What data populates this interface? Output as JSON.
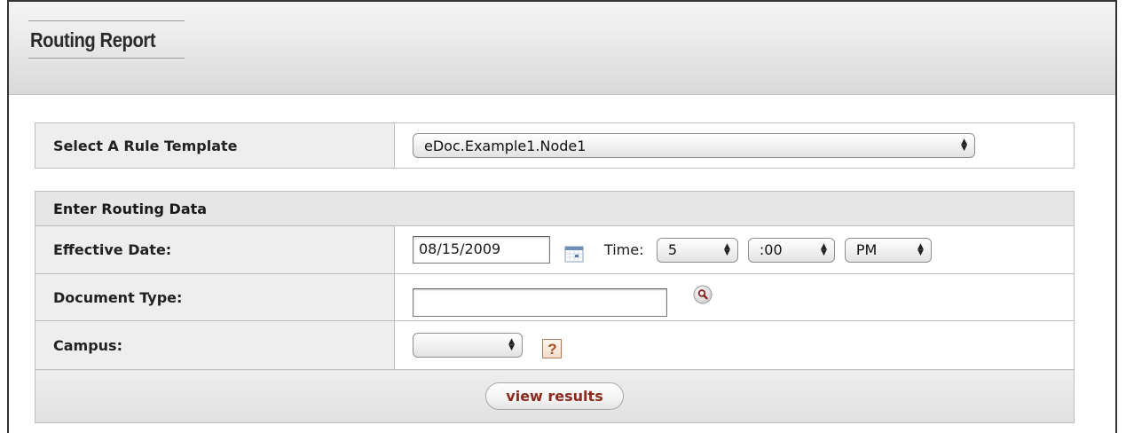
{
  "page": {
    "title": "Routing Report"
  },
  "rule_template": {
    "label": "Select A Rule Template",
    "selected": "eDoc.Example1.Node1"
  },
  "routing_data": {
    "section_title": "Enter Routing Data",
    "effective_date": {
      "label": "Effective Date:",
      "value": "08/15/2009",
      "time_label": "Time:",
      "hour": "5",
      "minute": ":00",
      "ampm": "PM"
    },
    "document_type": {
      "label": "Document Type:",
      "value": ""
    },
    "campus": {
      "label": "Campus:",
      "selected": "",
      "help_glyph": "?"
    },
    "view_results_label": "view results"
  },
  "icons": {
    "select_arrows": "updown-arrows-icon",
    "calendar": "calendar-icon",
    "lookup": "magnifier-lookup-icon",
    "help": "help-question-icon"
  },
  "colors": {
    "button_text": "#8b2a1f",
    "label_bg": "#eeeeee",
    "help_accent": "#a0502a"
  }
}
